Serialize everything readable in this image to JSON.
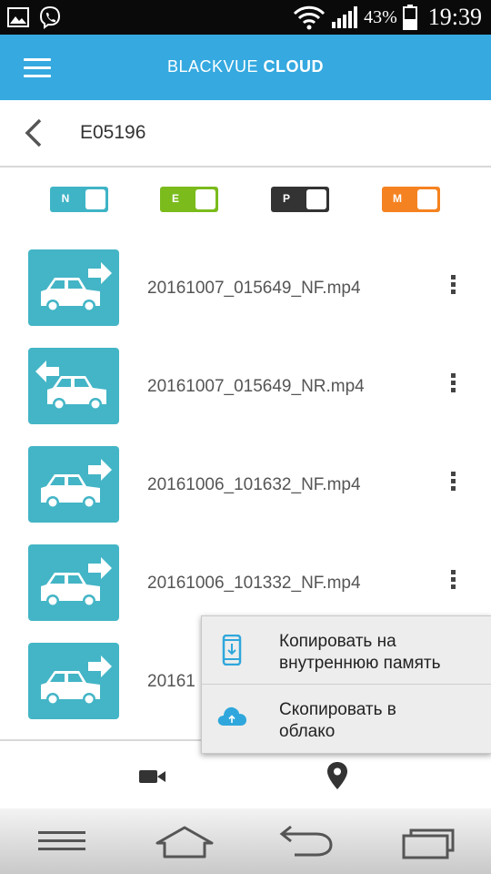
{
  "status_bar": {
    "battery_percent": "43%",
    "time": "19:39",
    "icons": [
      "image-icon",
      "viber-icon",
      "wifi-icon",
      "signal-icon",
      "battery-icon"
    ]
  },
  "app_bar": {
    "title_light": "BLACKVUE ",
    "title_bold": "CLOUD",
    "menu_icon": "hamburger-icon"
  },
  "device_header": {
    "name": "E05196",
    "back_icon": "chevron-left-icon"
  },
  "filters": [
    {
      "label": "N",
      "color": "#3fb4c6",
      "on": true
    },
    {
      "label": "E",
      "color": "#7bbb1c",
      "on": true
    },
    {
      "label": "P",
      "color": "#333333",
      "on": true
    },
    {
      "label": "M",
      "color": "#f58220",
      "on": true
    }
  ],
  "files": [
    {
      "name": "20161007_015649_NF.mp4",
      "direction": "front"
    },
    {
      "name": "20161007_015649_NR.mp4",
      "direction": "rear"
    },
    {
      "name": "20161006_101632_NF.mp4",
      "direction": "front"
    },
    {
      "name": "20161006_101332_NF.mp4",
      "direction": "front"
    },
    {
      "name": "20161",
      "direction": "front"
    }
  ],
  "context_menu": {
    "items": [
      {
        "line1": "Копировать на",
        "line2": "внутреннюю память",
        "icon": "phone-download-icon"
      },
      {
        "line1": "Скопировать в",
        "line2": "облако",
        "icon": "cloud-upload-icon"
      }
    ]
  },
  "bottom_bar": {
    "icons": [
      "video-camera-icon",
      "location-pin-icon"
    ]
  },
  "system_nav": {
    "icons": [
      "menu-icon",
      "home-icon",
      "back-icon",
      "recent-apps-icon"
    ]
  },
  "colors": {
    "app_bar": "#35a9e0",
    "thumbnail": "#43b5c6"
  }
}
